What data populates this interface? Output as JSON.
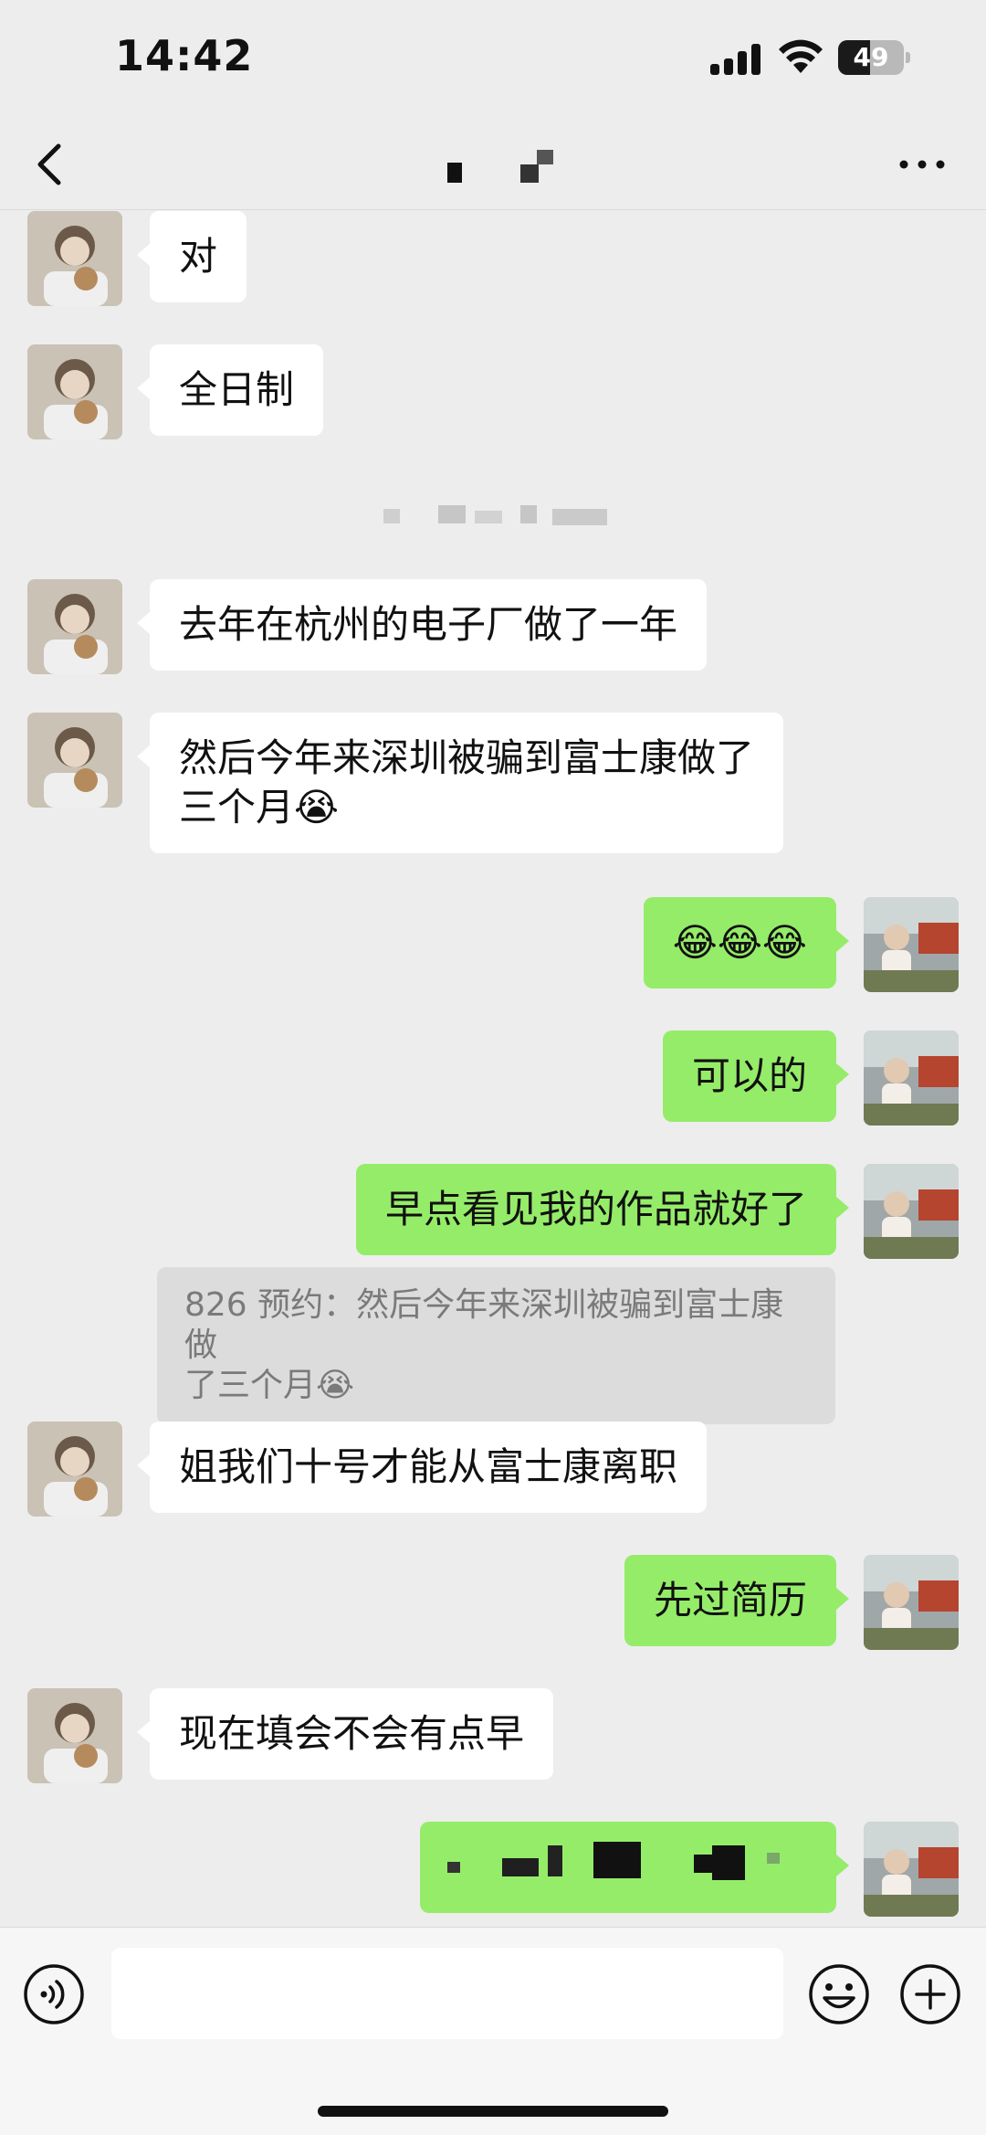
{
  "status_bar": {
    "time": "14:42",
    "battery_level": "49"
  },
  "nav": {
    "back_icon": "chevron-left-icon",
    "more_icon": "ellipsis-icon"
  },
  "colors": {
    "background": "#ededed",
    "incoming_bubble": "#ffffff",
    "outgoing_bubble": "#95ec69",
    "quote_bg": "#dcdcdc"
  },
  "messages": [
    {
      "sender": "other",
      "text": "对"
    },
    {
      "sender": "other",
      "text": "全日制"
    },
    {
      "sender": "other",
      "text": "去年在杭州的电子厂做了一年"
    },
    {
      "sender": "other",
      "line1": "然后今年来深圳被骗到富士康做了",
      "line2": "三个月",
      "emoji": "😭"
    },
    {
      "sender": "me",
      "text": "😂😂😂"
    },
    {
      "sender": "me",
      "text": "可以的"
    },
    {
      "sender": "me",
      "text": "早点看见我的作品就好了"
    },
    {
      "sender": "quote",
      "line1": "826 预约：然后今年来深圳被骗到富士康做",
      "line2": "了三个月",
      "emoji": "😭"
    },
    {
      "sender": "other",
      "text": "姐我们十号才能从富士康离职"
    },
    {
      "sender": "me",
      "text": "先过简历"
    },
    {
      "sender": "other",
      "text": "现在填会不会有点早"
    }
  ],
  "input_bar": {
    "voice_icon": "voice-icon",
    "emoji_icon": "smile-icon",
    "plus_icon": "plus-icon"
  }
}
